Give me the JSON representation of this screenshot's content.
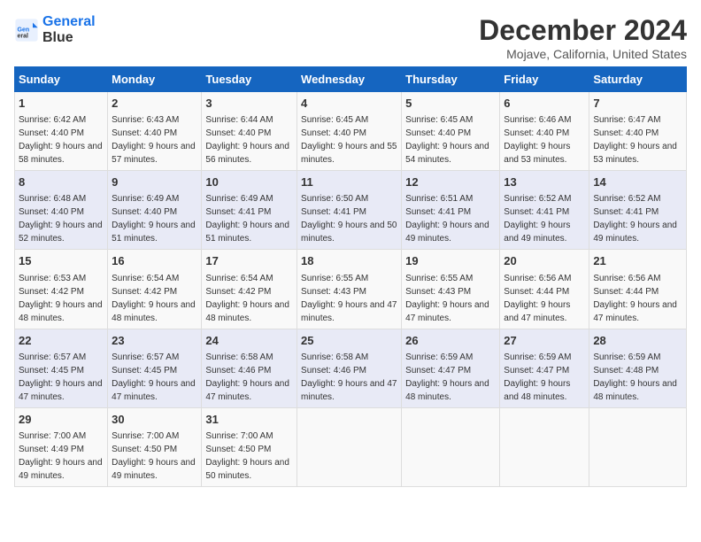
{
  "header": {
    "logo_line1": "General",
    "logo_line2": "Blue",
    "title": "December 2024",
    "subtitle": "Mojave, California, United States"
  },
  "days_of_week": [
    "Sunday",
    "Monday",
    "Tuesday",
    "Wednesday",
    "Thursday",
    "Friday",
    "Saturday"
  ],
  "weeks": [
    [
      {
        "day": "1",
        "sunrise": "6:42 AM",
        "sunset": "4:40 PM",
        "daylight": "9 hours and 58 minutes."
      },
      {
        "day": "2",
        "sunrise": "6:43 AM",
        "sunset": "4:40 PM",
        "daylight": "9 hours and 57 minutes."
      },
      {
        "day": "3",
        "sunrise": "6:44 AM",
        "sunset": "4:40 PM",
        "daylight": "9 hours and 56 minutes."
      },
      {
        "day": "4",
        "sunrise": "6:45 AM",
        "sunset": "4:40 PM",
        "daylight": "9 hours and 55 minutes."
      },
      {
        "day": "5",
        "sunrise": "6:45 AM",
        "sunset": "4:40 PM",
        "daylight": "9 hours and 54 minutes."
      },
      {
        "day": "6",
        "sunrise": "6:46 AM",
        "sunset": "4:40 PM",
        "daylight": "9 hours and 53 minutes."
      },
      {
        "day": "7",
        "sunrise": "6:47 AM",
        "sunset": "4:40 PM",
        "daylight": "9 hours and 53 minutes."
      }
    ],
    [
      {
        "day": "8",
        "sunrise": "6:48 AM",
        "sunset": "4:40 PM",
        "daylight": "9 hours and 52 minutes."
      },
      {
        "day": "9",
        "sunrise": "6:49 AM",
        "sunset": "4:40 PM",
        "daylight": "9 hours and 51 minutes."
      },
      {
        "day": "10",
        "sunrise": "6:49 AM",
        "sunset": "4:41 PM",
        "daylight": "9 hours and 51 minutes."
      },
      {
        "day": "11",
        "sunrise": "6:50 AM",
        "sunset": "4:41 PM",
        "daylight": "9 hours and 50 minutes."
      },
      {
        "day": "12",
        "sunrise": "6:51 AM",
        "sunset": "4:41 PM",
        "daylight": "9 hours and 49 minutes."
      },
      {
        "day": "13",
        "sunrise": "6:52 AM",
        "sunset": "4:41 PM",
        "daylight": "9 hours and 49 minutes."
      },
      {
        "day": "14",
        "sunrise": "6:52 AM",
        "sunset": "4:41 PM",
        "daylight": "9 hours and 49 minutes."
      }
    ],
    [
      {
        "day": "15",
        "sunrise": "6:53 AM",
        "sunset": "4:42 PM",
        "daylight": "9 hours and 48 minutes."
      },
      {
        "day": "16",
        "sunrise": "6:54 AM",
        "sunset": "4:42 PM",
        "daylight": "9 hours and 48 minutes."
      },
      {
        "day": "17",
        "sunrise": "6:54 AM",
        "sunset": "4:42 PM",
        "daylight": "9 hours and 48 minutes."
      },
      {
        "day": "18",
        "sunrise": "6:55 AM",
        "sunset": "4:43 PM",
        "daylight": "9 hours and 47 minutes."
      },
      {
        "day": "19",
        "sunrise": "6:55 AM",
        "sunset": "4:43 PM",
        "daylight": "9 hours and 47 minutes."
      },
      {
        "day": "20",
        "sunrise": "6:56 AM",
        "sunset": "4:44 PM",
        "daylight": "9 hours and 47 minutes."
      },
      {
        "day": "21",
        "sunrise": "6:56 AM",
        "sunset": "4:44 PM",
        "daylight": "9 hours and 47 minutes."
      }
    ],
    [
      {
        "day": "22",
        "sunrise": "6:57 AM",
        "sunset": "4:45 PM",
        "daylight": "9 hours and 47 minutes."
      },
      {
        "day": "23",
        "sunrise": "6:57 AM",
        "sunset": "4:45 PM",
        "daylight": "9 hours and 47 minutes."
      },
      {
        "day": "24",
        "sunrise": "6:58 AM",
        "sunset": "4:46 PM",
        "daylight": "9 hours and 47 minutes."
      },
      {
        "day": "25",
        "sunrise": "6:58 AM",
        "sunset": "4:46 PM",
        "daylight": "9 hours and 47 minutes."
      },
      {
        "day": "26",
        "sunrise": "6:59 AM",
        "sunset": "4:47 PM",
        "daylight": "9 hours and 48 minutes."
      },
      {
        "day": "27",
        "sunrise": "6:59 AM",
        "sunset": "4:47 PM",
        "daylight": "9 hours and 48 minutes."
      },
      {
        "day": "28",
        "sunrise": "6:59 AM",
        "sunset": "4:48 PM",
        "daylight": "9 hours and 48 minutes."
      }
    ],
    [
      {
        "day": "29",
        "sunrise": "7:00 AM",
        "sunset": "4:49 PM",
        "daylight": "9 hours and 49 minutes."
      },
      {
        "day": "30",
        "sunrise": "7:00 AM",
        "sunset": "4:50 PM",
        "daylight": "9 hours and 49 minutes."
      },
      {
        "day": "31",
        "sunrise": "7:00 AM",
        "sunset": "4:50 PM",
        "daylight": "9 hours and 50 minutes."
      },
      {
        "day": "",
        "sunrise": "",
        "sunset": "",
        "daylight": ""
      },
      {
        "day": "",
        "sunrise": "",
        "sunset": "",
        "daylight": ""
      },
      {
        "day": "",
        "sunrise": "",
        "sunset": "",
        "daylight": ""
      },
      {
        "day": "",
        "sunrise": "",
        "sunset": "",
        "daylight": ""
      }
    ]
  ],
  "labels": {
    "sunrise_prefix": "Sunrise: ",
    "sunset_prefix": "Sunset: ",
    "daylight_prefix": "Daylight: "
  }
}
